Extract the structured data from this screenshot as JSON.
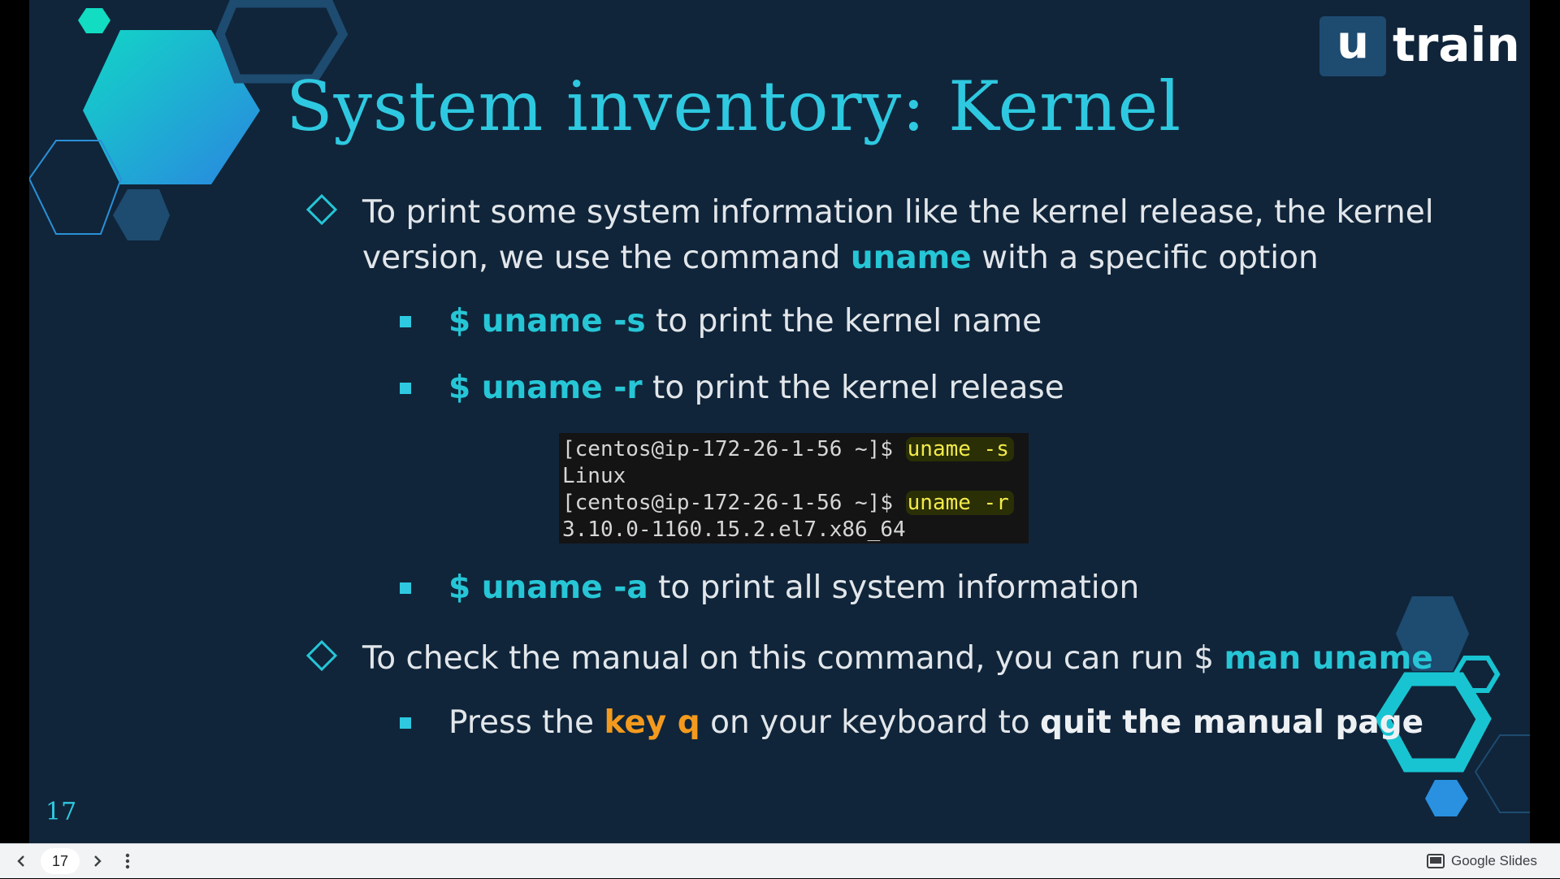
{
  "slide": {
    "title": "System inventory: Kernel",
    "page_number": "17",
    "logo": {
      "box_letter": "u",
      "word": "train"
    },
    "bullets": [
      {
        "line1": "To print some system information like the kernel release, the kernel",
        "line2_pre": "version, we use the command ",
        "line2_cmd": "uname",
        "line2_post": " with a specific option"
      },
      {
        "cmd": "$ uname -s",
        "text": " to print the kernel name"
      },
      {
        "cmd": "$ uname -r",
        "text": " to print the kernel release"
      },
      {
        "cmd": "$ uname -a",
        "text": " to print all system information"
      },
      {
        "pre": "To check the manual on this command, you can run $ ",
        "cmd": "man uname"
      },
      {
        "pre": "Press the ",
        "key": "key q",
        "mid": " on your keyboard to ",
        "bold": "quit the manual page"
      }
    ],
    "terminal": {
      "prompt1": "[centos@ip-172-26-1-56 ~]$ ",
      "cmd1": "uname -s",
      "out1": "Linux",
      "prompt2": "[centos@ip-172-26-1-56 ~]$ ",
      "cmd2": "uname -r",
      "out2": "3.10.0-1160.15.2.el7.x86_64"
    }
  },
  "toolbar": {
    "prev_icon": "chevron-left-icon",
    "next_icon": "chevron-right-icon",
    "menu_icon": "more-vert-icon",
    "current_page": "17",
    "brand_label": "Google Slides"
  },
  "colors": {
    "slide_bg": "#10253a",
    "accent_cyan": "#26c6d6",
    "accent_orange": "#f39a1e",
    "text": "#e2e6ea",
    "logo_box": "#1e4b70",
    "toolbar_bg": "#f1f3f4"
  }
}
